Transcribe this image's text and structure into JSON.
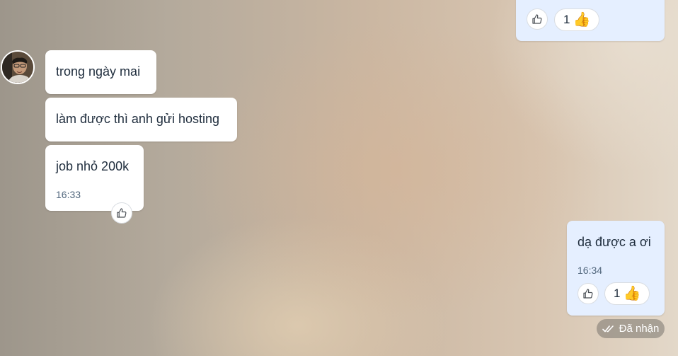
{
  "colors": {
    "incoming_bubble": "#ffffff",
    "outgoing_bubble": "#e5efff",
    "text": "#1f2d3d",
    "timestamp": "#53687e"
  },
  "icons": {
    "like": "thumbs-up-outline-icon",
    "reaction": "thumbs-up-emoji",
    "status": "double-check-icon"
  },
  "top_message": {
    "reaction_count": "1",
    "reaction_emoji": "👍"
  },
  "incoming_messages": [
    {
      "text": "trong ngày mai"
    },
    {
      "text": "làm được thì anh gửi hosting"
    },
    {
      "text": "job nhỏ 200k",
      "time": "16:33"
    }
  ],
  "outgoing_message": {
    "text": "dạ được a ơi",
    "time": "16:34",
    "reaction_count": "1",
    "reaction_emoji": "👍"
  },
  "status": {
    "label": "Đã nhận"
  }
}
